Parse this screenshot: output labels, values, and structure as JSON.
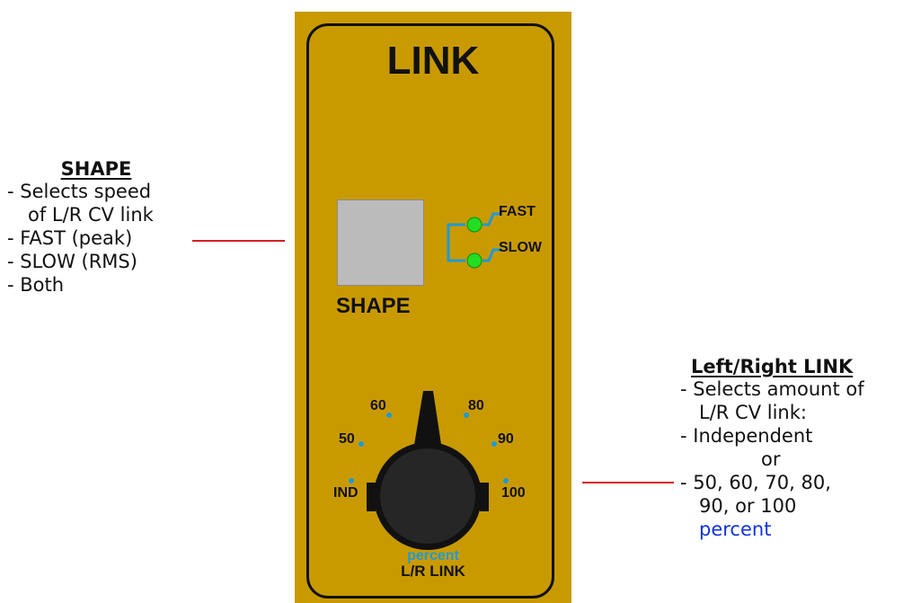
{
  "left_note": {
    "heading": "SHAPE",
    "lines": [
      "- Selects speed",
      "of L/R CV link",
      "- FAST (peak)",
      "- SLOW (RMS)",
      "- Both"
    ]
  },
  "right_note": {
    "heading": "Left/Right LINK",
    "lines": [
      "- Selects amount of",
      "L/R CV link:",
      "- Independent",
      "or",
      "- 50, 60, 70, 80,",
      "90, or 100"
    ],
    "last_line": "percent"
  },
  "panel": {
    "title": "LINK",
    "shape_label": "SHAPE",
    "led_fast": "FAST",
    "led_slow": "SLOW",
    "knob_positions": [
      "IND",
      "50",
      "60",
      "80",
      "90",
      "100"
    ],
    "knob_unit": "percent",
    "knob_label": "L/R LINK"
  },
  "colors": {
    "panel": "#c99a00",
    "led": "#22dd22",
    "wire": "#1e9ad6",
    "leader": "#d42020",
    "accent_text": "#1133dd"
  }
}
